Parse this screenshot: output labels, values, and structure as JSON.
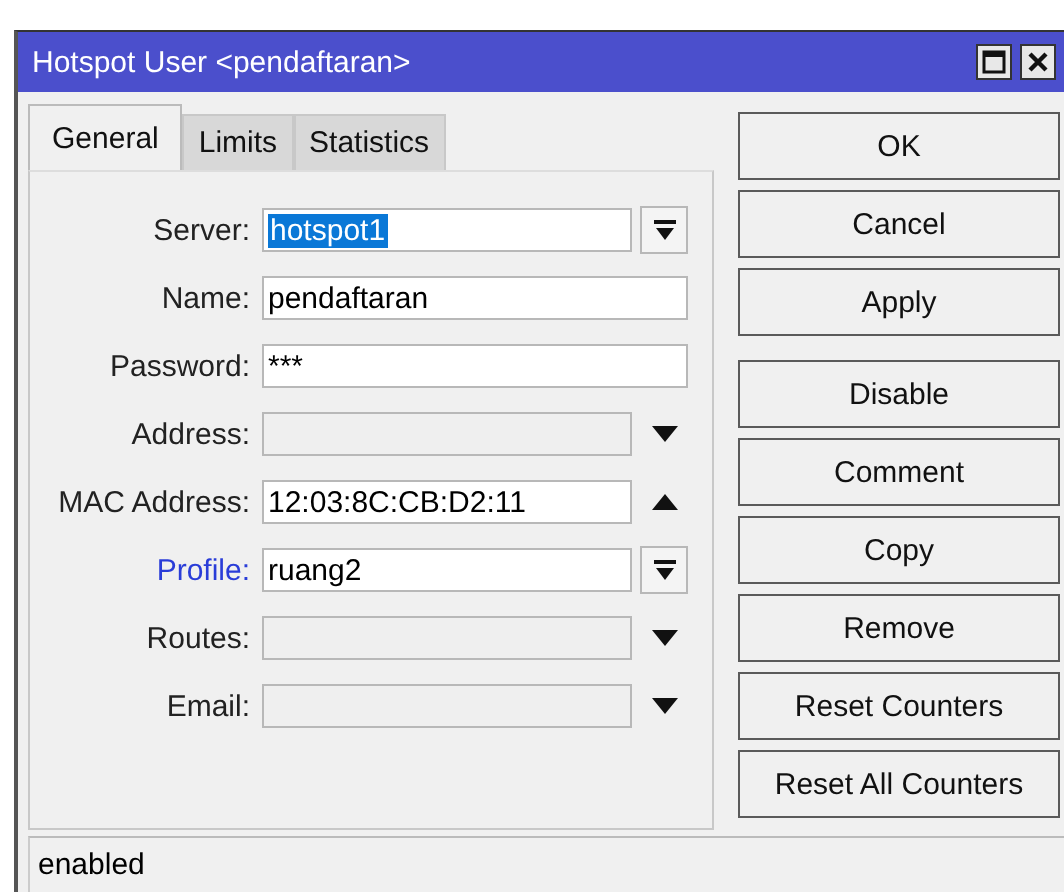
{
  "window": {
    "title": "Hotspot User <pendaftaran>"
  },
  "tabs": [
    {
      "label": "General",
      "selected": true
    },
    {
      "label": "Limits",
      "selected": false
    },
    {
      "label": "Statistics",
      "selected": false
    }
  ],
  "fields": [
    {
      "label": "Server:",
      "kind": "select",
      "value": "hotspot1",
      "highlighted": true,
      "link": false,
      "disabled": false
    },
    {
      "label": "Name:",
      "kind": "text",
      "value": "pendaftaran",
      "highlighted": false,
      "link": false,
      "disabled": false
    },
    {
      "label": "Password:",
      "kind": "text",
      "value": "***",
      "highlighted": false,
      "link": false,
      "disabled": false
    },
    {
      "label": "Address:",
      "kind": "optional",
      "expanded": false,
      "link": false,
      "disabled": true
    },
    {
      "label": "MAC Address:",
      "kind": "optional",
      "expanded": true,
      "value": "12:03:8C:CB:D2:11",
      "highlighted": false,
      "link": false,
      "disabled": false
    },
    {
      "label": "Profile:",
      "kind": "select",
      "value": "ruang2",
      "highlighted": false,
      "link": true,
      "disabled": false
    },
    {
      "label": "Routes:",
      "kind": "optional",
      "expanded": false,
      "link": false,
      "disabled": true
    },
    {
      "label": "Email:",
      "kind": "optional",
      "expanded": false,
      "link": false,
      "disabled": true
    }
  ],
  "button_groups": [
    [
      "OK",
      "Cancel",
      "Apply"
    ],
    [
      "Disable",
      "Comment",
      "Copy",
      "Remove",
      "Reset Counters",
      "Reset All Counters"
    ]
  ],
  "status_bar": "enabled"
}
